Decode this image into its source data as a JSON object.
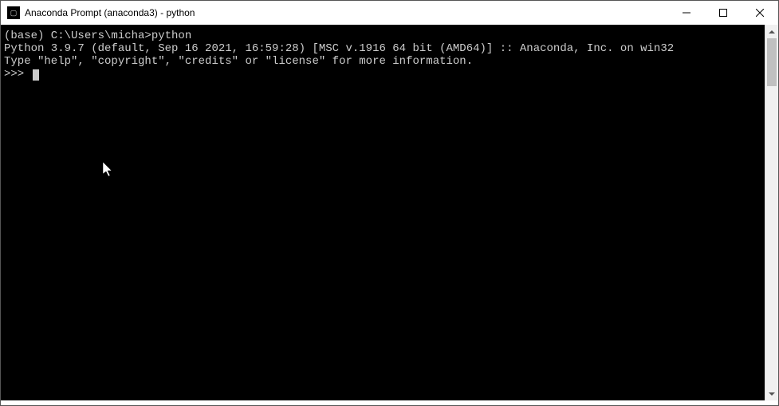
{
  "titlebar": {
    "title": "Anaconda Prompt (anaconda3) - python"
  },
  "terminal": {
    "line1": "(base) C:\\Users\\micha>python",
    "line2": "Python 3.9.7 (default, Sep 16 2021, 16:59:28) [MSC v.1916 64 bit (AMD64)] :: Anaconda, Inc. on win32",
    "line3": "Type \"help\", \"copyright\", \"credits\" or \"license\" for more information.",
    "prompt": ">>> "
  }
}
